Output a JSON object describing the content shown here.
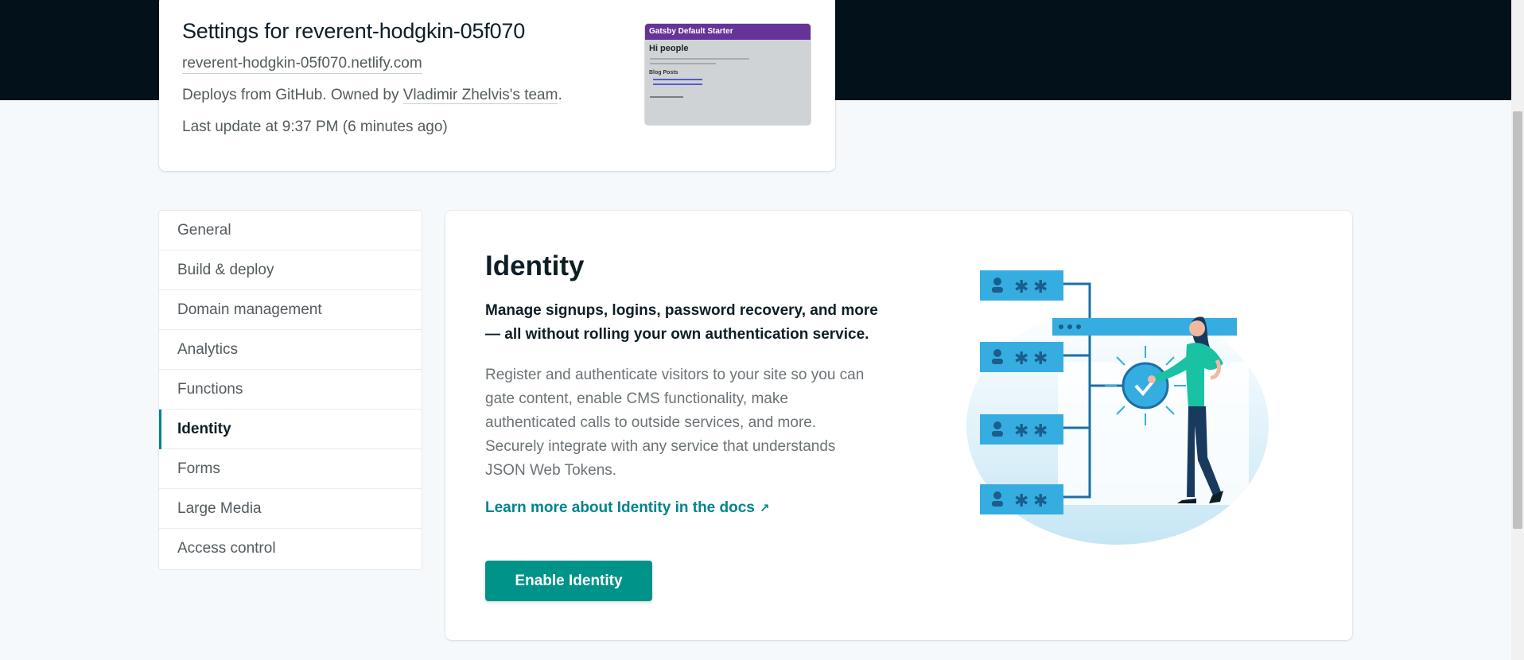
{
  "site": {
    "title": "Settings for reverent-hodgkin-05f070",
    "url": "reverent-hodgkin-05f070.netlify.com",
    "deploys_prefix": "Deploys from GitHub. Owned by ",
    "owner": "Vladimir Zhelvis's team",
    "deploys_suffix": ".",
    "last_update": "Last update at 9:37 PM (6 minutes ago)",
    "preview": {
      "header": "Gatsby Default Starter",
      "heading": "Hi people",
      "subheading": "Blog Posts"
    }
  },
  "sidebar": {
    "items": [
      {
        "label": "General"
      },
      {
        "label": "Build & deploy"
      },
      {
        "label": "Domain management"
      },
      {
        "label": "Analytics"
      },
      {
        "label": "Functions"
      },
      {
        "label": "Identity",
        "active": true
      },
      {
        "label": "Forms"
      },
      {
        "label": "Large Media"
      },
      {
        "label": "Access control"
      }
    ]
  },
  "identity": {
    "heading": "Identity",
    "lead": "Manage signups, logins, password recovery, and more — all without rolling your own authentication service.",
    "description": "Register and authenticate visitors to your site so you can gate content, enable CMS functionality, make authenticated calls to outside services, and more. Securely integrate with any service that understands JSON Web Tokens.",
    "docs_link": "Learn more about Identity in the docs",
    "docs_link_icon": "external-arrow-icon",
    "enable_button": "Enable Identity"
  },
  "colors": {
    "teal": "#00938a",
    "link": "#00838f",
    "dark_band": "#02111a",
    "illustration_blue": "#36ade0"
  }
}
